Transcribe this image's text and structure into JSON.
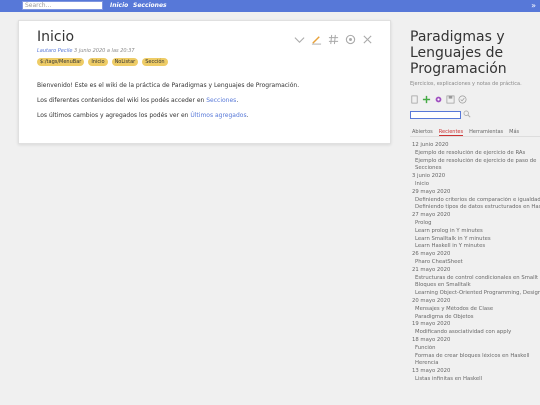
{
  "topbar": {
    "search_placeholder": "Search...",
    "links": [
      "Inicio",
      "Secciones"
    ],
    "chevron": "»"
  },
  "tiddler": {
    "title": "Inicio",
    "author": "Lautaro Pecile",
    "date": "3 junio 2020 a las 20:37",
    "tags": [
      "$:/tags/MenuBar",
      "Inicio",
      "NoListar",
      "Sección"
    ],
    "toolbar_icons": [
      "chevron-down-icon",
      "edit-icon",
      "hash-icon",
      "more-icon",
      "close-icon"
    ],
    "para1": "Bienvenido! Este es el wiki de la práctica de Paradigmas y Lenguajes de Programación.",
    "para2_text": "Los diferentes contenidos del wiki los podés acceder en ",
    "para2_link": "Secciones",
    "para2_end": ".",
    "para3_text": "Los últimos cambios y agregados los podés ver en ",
    "para3_link": "Últimos agregados",
    "para3_end": "."
  },
  "sidebar": {
    "title_line1": "Paradigmas y",
    "title_line2": "Lenguajes de",
    "title_line3": "Programación",
    "subtitle": "Ejercicios, explicaciones y notas de práctica.",
    "tabs": [
      "Abiertos",
      "Recientes",
      "Herramientas",
      "Más"
    ],
    "active_tab": "Recientes",
    "recent": [
      {
        "date": "12 junio 2020",
        "items": [
          "Ejemplo de resolución de ejercicio de RAs",
          "Ejemplo de resolución de ejercicio de paso de",
          "Secciones"
        ]
      },
      {
        "date": "3 junio 2020",
        "items": [
          "Inicio"
        ]
      },
      {
        "date": "29 mayo 2020",
        "items": [
          "Definiendo criterios de comparación e igualdad",
          "Definiendo tipos de datos estructurados en Has"
        ]
      },
      {
        "date": "27 mayo 2020",
        "items": [
          "Prolog",
          "Learn prolog in Y minutes",
          "Learn Smalltalk in Y minutes",
          "Learn Haskell in Y minutes"
        ]
      },
      {
        "date": "26 mayo 2020",
        "items": [
          "Pharo CheatSheet"
        ]
      },
      {
        "date": "21 mayo 2020",
        "items": [
          "Estructuras de control condicionales en Smallt",
          "Bloques en Smalltalk",
          "Learning Object-Oriented Programming, Design"
        ]
      },
      {
        "date": "20 mayo 2020",
        "items": [
          "Mensajes y Métodos de Clase",
          "Paradigma de Objetos"
        ]
      },
      {
        "date": "19 mayo 2020",
        "items": [
          "Modificando asociatividad con apply"
        ]
      },
      {
        "date": "18 mayo 2020",
        "items": [
          "Función",
          "Formas de crear bloques léxicos en Haskell",
          "Herencia"
        ]
      },
      {
        "date": "13 mayo 2020",
        "items": [
          "Listas infinitas en Haskell"
        ]
      }
    ]
  }
}
